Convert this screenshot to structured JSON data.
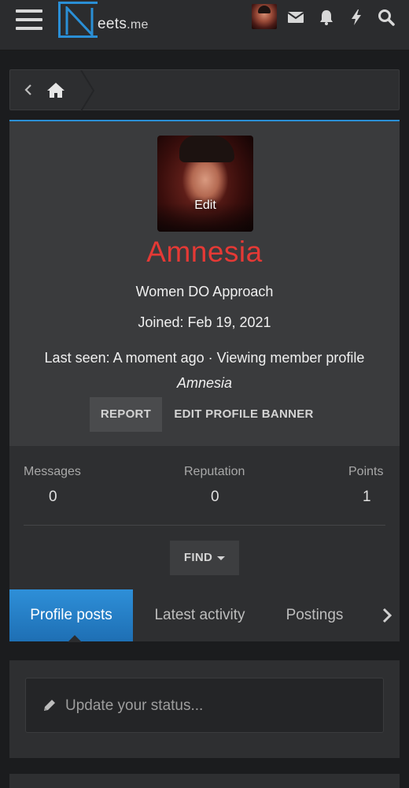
{
  "header": {
    "logo_letter": "N",
    "logo_text": "eets",
    "logo_tld": ".me",
    "icons": [
      "menu-icon",
      "user-avatar",
      "envelope-icon",
      "bell-icon",
      "bolt-icon",
      "search-icon"
    ]
  },
  "breadcrumb": {
    "icons": [
      "chevron-left-icon",
      "home-icon"
    ]
  },
  "profile": {
    "avatar_edit_label": "Edit",
    "username": "Amnesia",
    "user_title": "Women DO Approach",
    "joined": "Joined: Feb 19, 2021",
    "last_seen": "Last seen: A moment ago · Viewing member profile",
    "last_seen_target": "Amnesia",
    "report_label": "REPORT",
    "edit_banner_label": "EDIT PROFILE BANNER",
    "username_color": "#e53935"
  },
  "stats": {
    "messages_label": "Messages",
    "messages_value": "0",
    "reputation_label": "Reputation",
    "reputation_value": "0",
    "points_label": "Points",
    "points_value": "1",
    "find_label": "FIND"
  },
  "tabs": [
    {
      "label": "Profile posts",
      "active": true
    },
    {
      "label": "Latest activity",
      "active": false
    },
    {
      "label": "Postings",
      "active": false
    }
  ],
  "status": {
    "placeholder": "Update your status..."
  },
  "colors": {
    "accent": "#2a8fd6",
    "background": "#1b1c1e",
    "card": "#3a3b3d"
  }
}
